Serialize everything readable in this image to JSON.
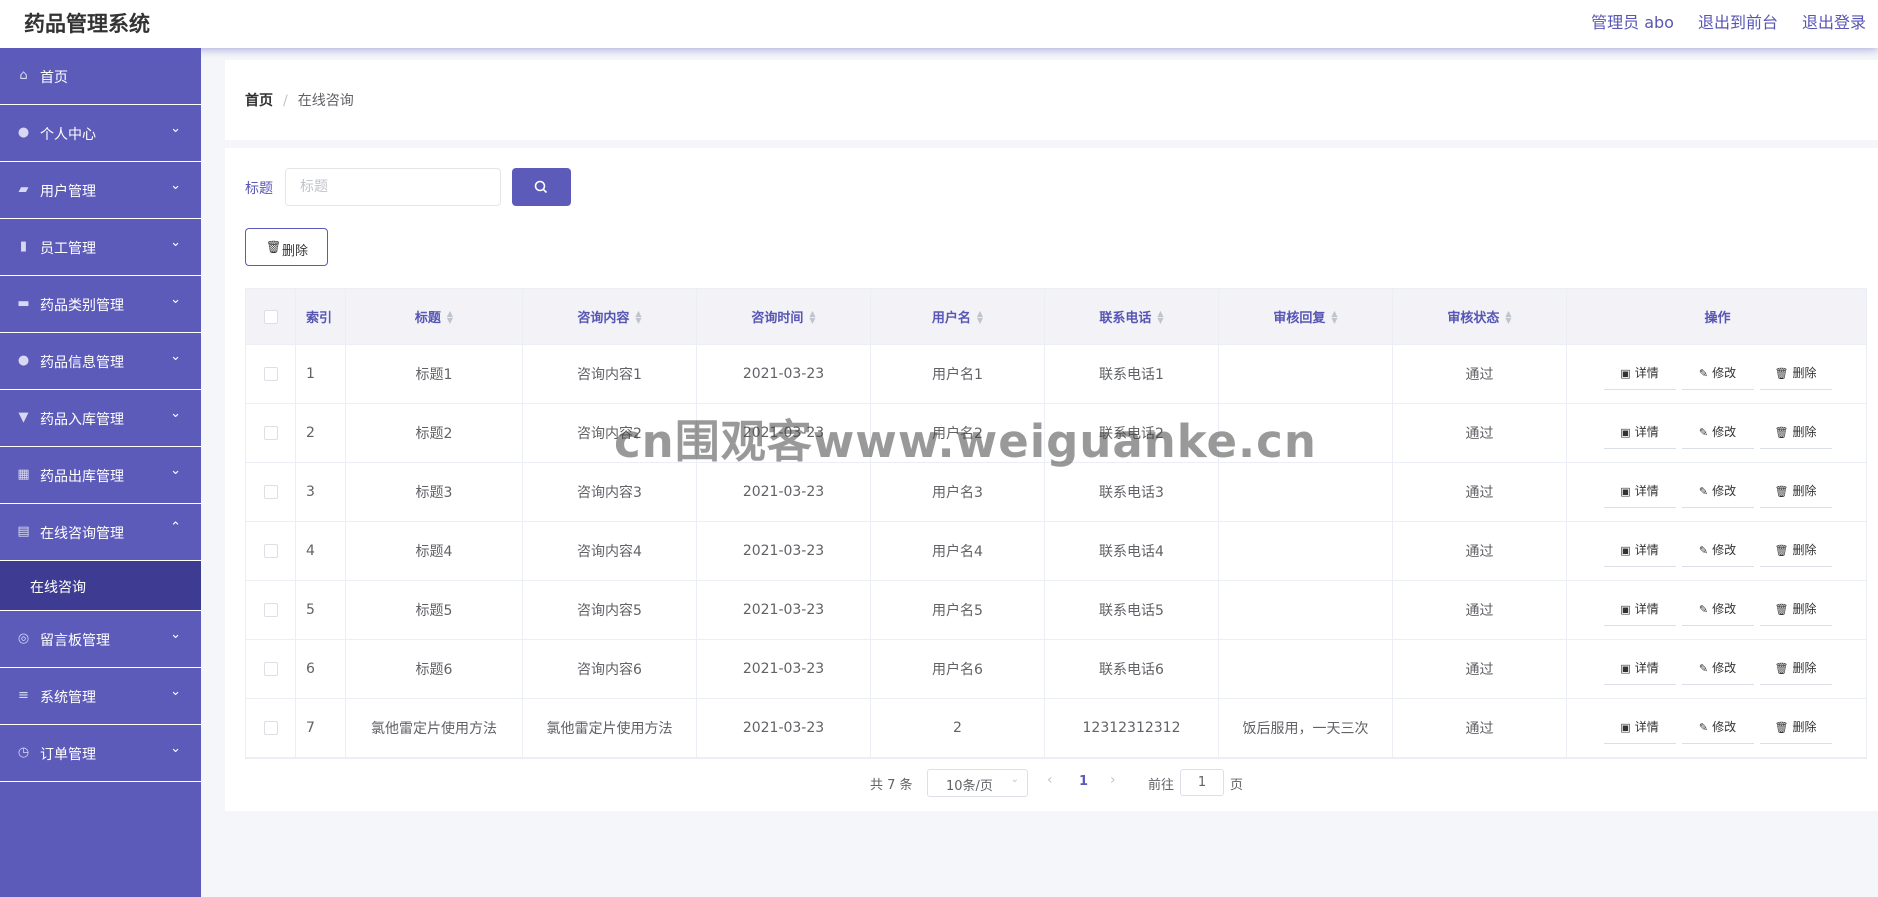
{
  "header": {
    "title": "药品管理系统",
    "links": [
      "管理员 abo",
      "退出到前台",
      "退出登录"
    ]
  },
  "sidebar": {
    "items": [
      {
        "label": "首页",
        "icon": "home-icon",
        "glyph": "⌂",
        "arrow": ""
      },
      {
        "label": "个人中心",
        "icon": "user-icon",
        "glyph": "●",
        "arrow": "⌄"
      },
      {
        "label": "用户管理",
        "icon": "thumb-icon",
        "glyph": "▰",
        "arrow": "⌄"
      },
      {
        "label": "员工管理",
        "icon": "bar-chart-icon",
        "glyph": "▮",
        "arrow": "⌄"
      },
      {
        "label": "药品类别管理",
        "icon": "briefcase-icon",
        "glyph": "▬",
        "arrow": "⌄"
      },
      {
        "label": "药品信息管理",
        "icon": "user-icon",
        "glyph": "●",
        "arrow": "⌄"
      },
      {
        "label": "药品入库管理",
        "icon": "stamp-icon",
        "glyph": "▼",
        "arrow": "⌄"
      },
      {
        "label": "药品出库管理",
        "icon": "grid-icon",
        "glyph": "▦",
        "arrow": "⌄"
      },
      {
        "label": "在线咨询管理",
        "icon": "document-icon",
        "glyph": "▤",
        "arrow": "⌃"
      }
    ],
    "sub_item": "在线咨询",
    "items_after": [
      {
        "label": "留言板管理",
        "icon": "globe-icon",
        "glyph": "◎",
        "arrow": "⌄"
      },
      {
        "label": "系统管理",
        "icon": "sliders-icon",
        "glyph": "≡",
        "arrow": "⌄"
      },
      {
        "label": "订单管理",
        "icon": "compass-icon",
        "glyph": "◷",
        "arrow": "⌄"
      }
    ]
  },
  "breadcrumb": {
    "home": "首页",
    "separator": "/",
    "current": "在线咨询"
  },
  "search": {
    "label": "标题",
    "placeholder": "标题"
  },
  "toolbar": {
    "delete_label": "删除"
  },
  "table": {
    "columns": [
      "索引",
      "标题",
      "咨询内容",
      "咨询时间",
      "用户名",
      "联系电话",
      "审核回复",
      "审核状态",
      "操作"
    ],
    "rows": [
      [
        "1",
        "标题1",
        "咨询内容1",
        "2021-03-23",
        "用户名1",
        "联系电话1",
        "",
        "通过"
      ],
      [
        "2",
        "标题2",
        "咨询内容2",
        "2021-03-23",
        "用户名2",
        "联系电话2",
        "",
        "通过"
      ],
      [
        "3",
        "标题3",
        "咨询内容3",
        "2021-03-23",
        "用户名3",
        "联系电话3",
        "",
        "通过"
      ],
      [
        "4",
        "标题4",
        "咨询内容4",
        "2021-03-23",
        "用户名4",
        "联系电话4",
        "",
        "通过"
      ],
      [
        "5",
        "标题5",
        "咨询内容5",
        "2021-03-23",
        "用户名5",
        "联系电话5",
        "",
        "通过"
      ],
      [
        "6",
        "标题6",
        "咨询内容6",
        "2021-03-23",
        "用户名6",
        "联系电话6",
        "",
        "通过"
      ],
      [
        "7",
        "氯他雷定片使用方法",
        "氯他雷定片使用方法",
        "2021-03-23",
        "2",
        "12312312312",
        "饭后服用，一天三次",
        "通过"
      ]
    ],
    "actions": [
      "详情",
      "修改",
      "删除"
    ]
  },
  "pagination": {
    "total": "共 7 条",
    "page_size": "10条/页",
    "current": "1",
    "goto_label": "前往",
    "goto_value": "1",
    "page_suffix": "页"
  },
  "watermark": "cn围观客www.weiguanke.cn",
  "colors": {
    "accent": "#5d5bba",
    "sidebar_active": "#3e3c92"
  }
}
